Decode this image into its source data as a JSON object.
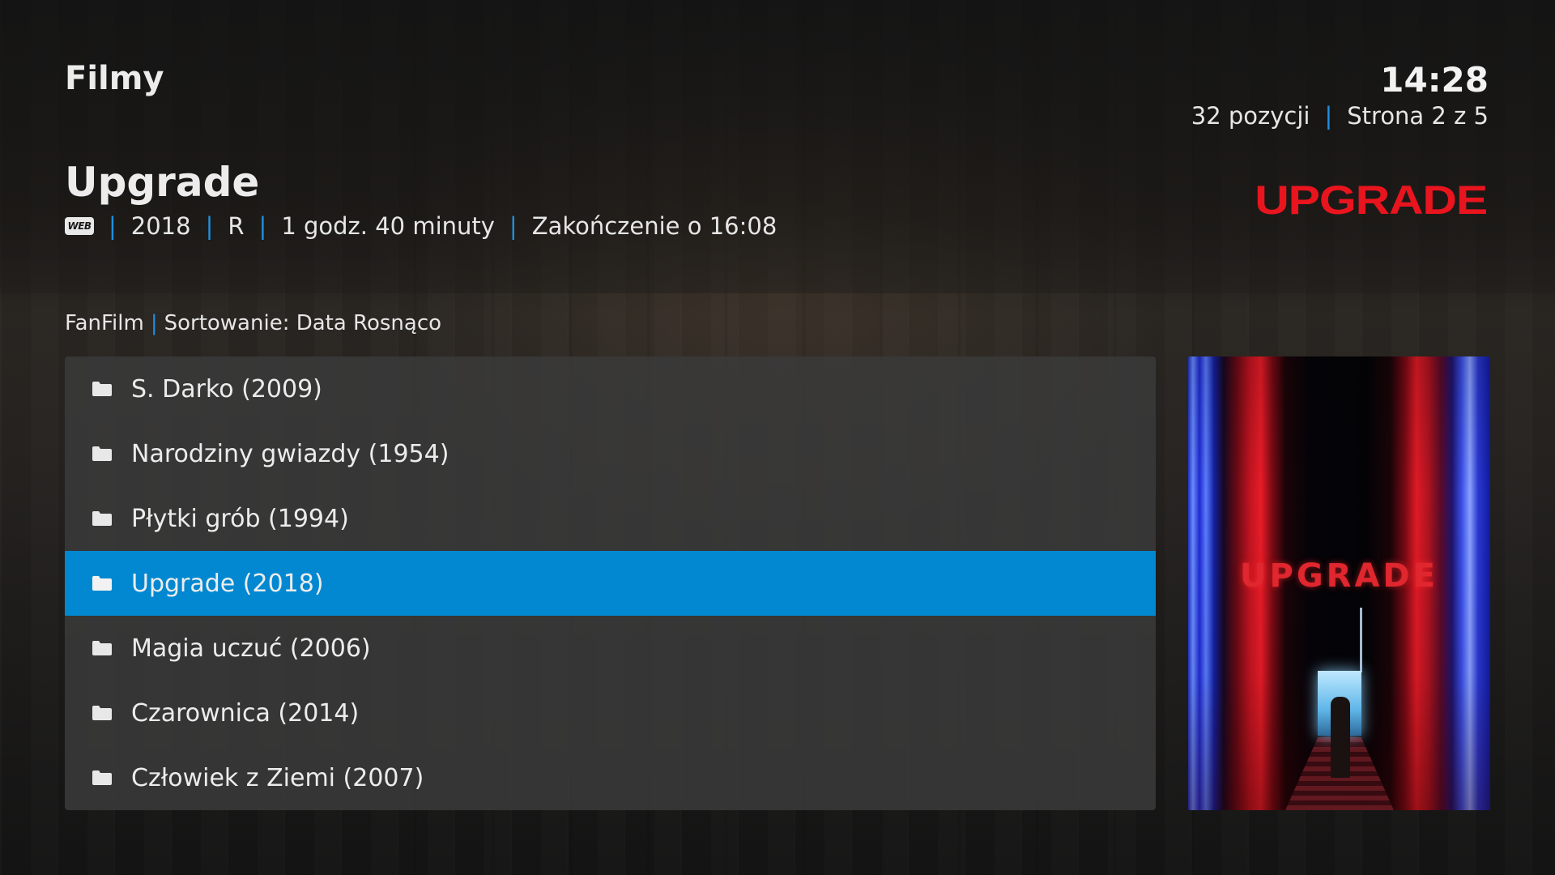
{
  "header": {
    "section_title": "Filmy",
    "clock": "14:28",
    "item_count": "32 pozycji",
    "page": "Strona 2 z 5"
  },
  "selected_movie": {
    "title": "Upgrade",
    "source_badge": "WEB",
    "year": "2018",
    "rating": "R",
    "runtime": "1 godz. 40 minuty",
    "ends_at": "Zakończenie o 16:08",
    "clearlogo_text": "UPGRADE",
    "poster_title": "UPGRADE"
  },
  "breadcrumb": {
    "source": "FanFilm",
    "sort": "Sortowanie: Data Rosnąco"
  },
  "list": {
    "items": [
      {
        "label": "S. Darko (2009)",
        "icon": "folder-icon"
      },
      {
        "label": "Narodziny gwiazdy (1954)",
        "icon": "folder-icon"
      },
      {
        "label": "Płytki grób (1994)",
        "icon": "folder-icon"
      },
      {
        "label": "Upgrade (2018)",
        "icon": "folder-icon"
      },
      {
        "label": "Magia uczuć (2006)",
        "icon": "folder-icon"
      },
      {
        "label": "Czarownica (2014)",
        "icon": "folder-icon"
      },
      {
        "label": "Człowiek z Ziemi (2007)",
        "icon": "folder-icon"
      }
    ],
    "selected_index": 3
  },
  "colors": {
    "accent": "#0288d1",
    "separator": "#1e90e0",
    "logo_red": "#e8141e"
  }
}
